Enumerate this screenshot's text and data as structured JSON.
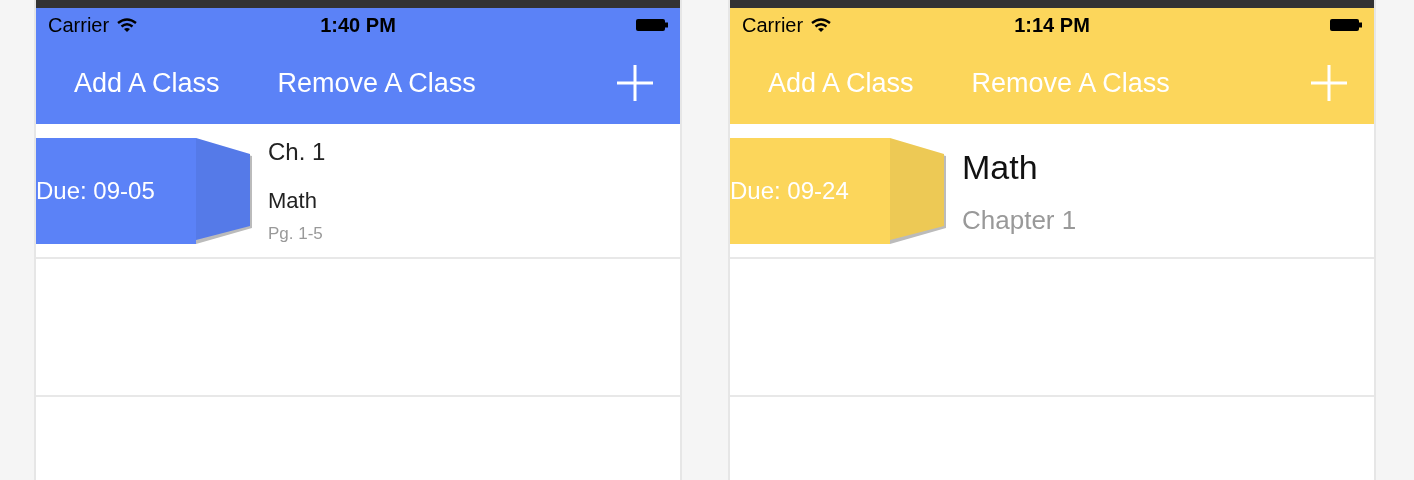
{
  "phones": [
    {
      "color": "#5b82f7",
      "status_bar": {
        "carrier": "Carrier",
        "time": "1:40 PM"
      },
      "nav_buttons": [
        "Add A Class",
        "Remove A Class"
      ],
      "assignments": [
        {
          "kind": "detailed",
          "due": "Due: 09-05",
          "title": "Ch. 1",
          "subtitle": "Math",
          "note": "Pg. 1-5"
        }
      ]
    },
    {
      "color": "#fcd65b",
      "status_bar": {
        "carrier": "Carrier",
        "time": "1:14 PM"
      },
      "nav_buttons": [
        "Add A Class",
        "Remove A Class"
      ],
      "assignments": [
        {
          "kind": "simple",
          "due": "Due: 09-24",
          "title": "Math",
          "subtitle": "Chapter 1"
        }
      ]
    }
  ]
}
